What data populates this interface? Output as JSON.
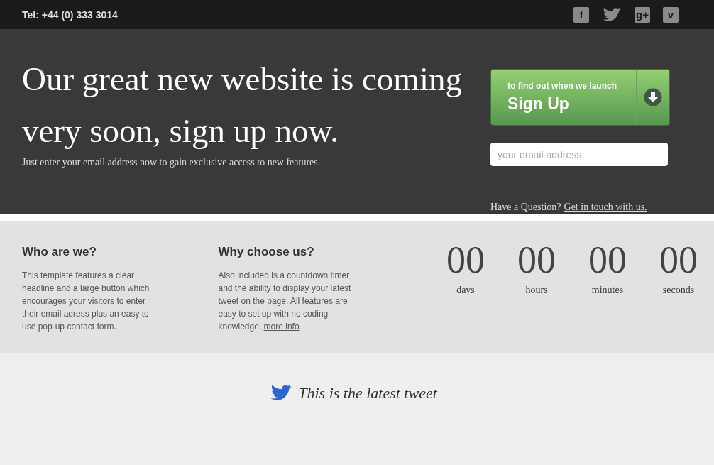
{
  "top_bar": {
    "phone": "Tel: +44 (0) 333 3014",
    "social": [
      {
        "kind": "glyph",
        "glyph": "f"
      },
      {
        "kind": "bird"
      },
      {
        "kind": "glyph",
        "glyph": "g+"
      },
      {
        "kind": "glyph",
        "glyph": "v"
      }
    ]
  },
  "hero": {
    "headline": "Our great new website is coming very soon, sign up now.",
    "subtext": "Just enter your email address now to gain exclusive access to new features.",
    "signup": {
      "caption": "to find out when we launch",
      "label": "Sign Up"
    },
    "email": {
      "placeholder": "your email address"
    },
    "question": {
      "text": "Have a Question?",
      "link": "Get in touch with us."
    }
  },
  "info": [
    {
      "heading": "Who are we?",
      "text": "This template features a clear headline and a large button which encourages your visitors to enter their email adress plus an easy to use pop-up contact form."
    },
    {
      "heading": "Why choose us?",
      "text": "Also included is a countdown timer and the ability to display your latest tweet on the page. All features are easy to set up with no coding knowledge, ",
      "link": "more info",
      "after": "."
    }
  ],
  "countdown": [
    {
      "value": "00",
      "unit": "days"
    },
    {
      "value": "00",
      "unit": "hours"
    },
    {
      "value": "00",
      "unit": "minutes"
    },
    {
      "value": "00",
      "unit": "seconds"
    }
  ],
  "tweet": {
    "text": "This is the latest tweet"
  }
}
